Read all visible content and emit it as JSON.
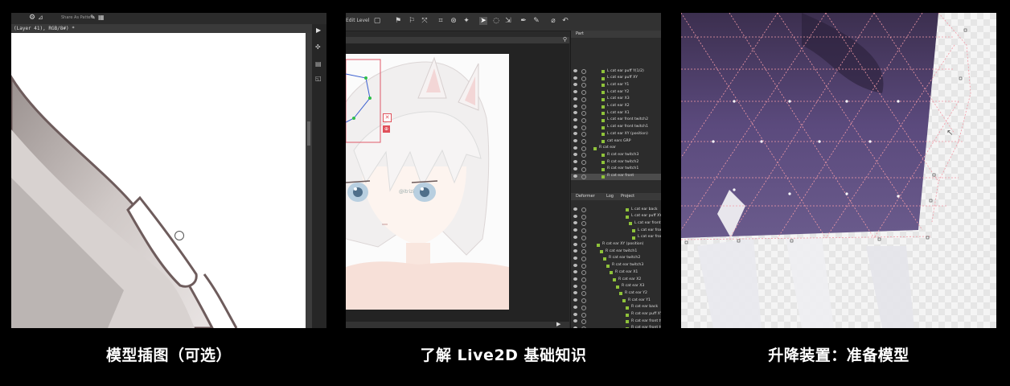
{
  "cards": [
    {
      "caption": "模型插图（可选）"
    },
    {
      "caption": "了解 Live2D 基础知识"
    },
    {
      "caption": "升降装置：准备模型"
    }
  ],
  "card1": {
    "doc_tab": "(Layer 41), RGB/8#) *",
    "toolbar_label": "Share As Pattern"
  },
  "card2": {
    "toolbar_label": "Edit Level",
    "part_panel_title": "Part",
    "part_rows": [
      "L cat ear puff Y(1/2)",
      "L cat ear puff XY",
      "L cat ear Y1",
      "L cat ear Y2",
      "L cat ear X3",
      "L cat ear X2",
      "L cat ear X1",
      "L cat ear front twitch2",
      "L cat ear front twitch1",
      "L cat ear XY (position)",
      "cat ears GRP",
      "R cat ear",
      "R cat ear twitch3",
      "R cat ear twitch2",
      "R cat ear twitch1",
      "R cat ear front"
    ],
    "bottom_tabs": [
      "Deformer",
      "Log",
      "Project"
    ],
    "deformer_rows": [
      "L cat ear back",
      "L cat ear puff XY",
      "L cat ear front tw",
      "L cat ear front tw",
      "L cat ear front",
      "R cat ear XY (position)",
      "R cat ear twitch1",
      "R cat ear twitch2",
      "R cat ear twitch3",
      "R cat ear X1",
      "R cat ear X2",
      "R cat ear X3",
      "R cat ear Y2",
      "R cat ear Y1",
      "R cat ear back",
      "R cat ear puff XY",
      "R cat ear front tw",
      "R cat ear front tw",
      "R cat ear front"
    ],
    "watermark": "@itrizi"
  }
}
